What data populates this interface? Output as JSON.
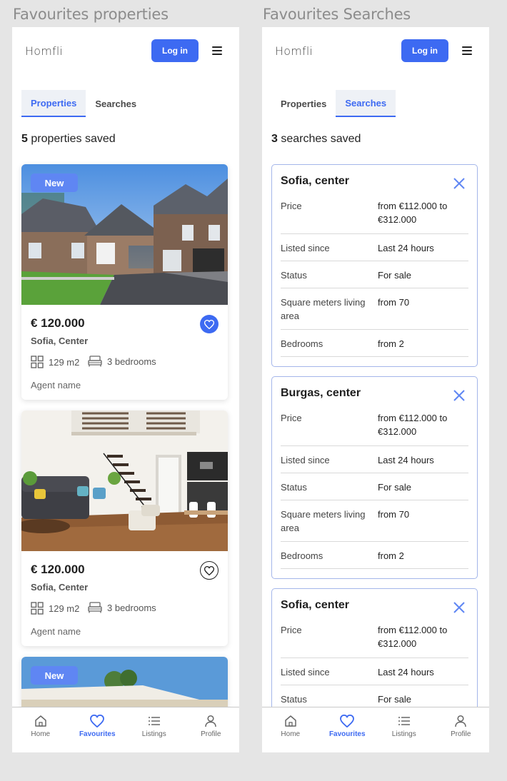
{
  "frames": {
    "left_title": "Favourites properties",
    "right_title": "Favourites Searches"
  },
  "header": {
    "logo": "Homfli",
    "login_label": "Log in"
  },
  "tabs": [
    "Properties",
    "Searches"
  ],
  "properties_view": {
    "active_tab": 0,
    "count": "5",
    "count_suffix": " properties saved",
    "cards": [
      {
        "badge": "New",
        "price": "€ 120.000",
        "location": "Sofia, Center",
        "area": "129 m2",
        "bedrooms": "3 bedrooms",
        "agent": "Agent name",
        "favourite": true
      },
      {
        "badge": "",
        "price": "€ 120.000",
        "location": "Sofia, Center",
        "area": "129 m2",
        "bedrooms": "3 bedrooms",
        "agent": "Agent name",
        "favourite": false
      },
      {
        "badge": "New"
      }
    ]
  },
  "searches_view": {
    "active_tab": 1,
    "count": "3",
    "count_suffix": " searches saved",
    "cards": [
      {
        "title": "Sofia, center",
        "rows": [
          {
            "k": "Price",
            "v": "from €112.000 to €312.000"
          },
          {
            "k": "Listed since",
            "v": "Last 24 hours"
          },
          {
            "k": "Status",
            "v": "For sale"
          },
          {
            "k": "Square meters living area",
            "v": "from 70"
          },
          {
            "k": "Bedrooms",
            "v": "from 2"
          }
        ]
      },
      {
        "title": "Burgas, center",
        "rows": [
          {
            "k": "Price",
            "v": "from €112.000 to €312.000"
          },
          {
            "k": "Listed since",
            "v": "Last 24 hours"
          },
          {
            "k": "Status",
            "v": "For sale"
          },
          {
            "k": "Square meters living area",
            "v": "from 70"
          },
          {
            "k": "Bedrooms",
            "v": "from 2"
          }
        ]
      },
      {
        "title": "Sofia, center",
        "rows": [
          {
            "k": "Price",
            "v": "from €112.000 to €312.000"
          },
          {
            "k": "Listed since",
            "v": "Last 24 hours"
          },
          {
            "k": "Status",
            "v": "For sale"
          }
        ]
      }
    ]
  },
  "bottom_nav": {
    "items": [
      {
        "label": "Home",
        "icon": "home-icon"
      },
      {
        "label": "Favourites",
        "icon": "heart-icon"
      },
      {
        "label": "Listings",
        "icon": "list-icon"
      },
      {
        "label": "Profile",
        "icon": "user-icon"
      }
    ],
    "active_index": 1
  },
  "colors": {
    "accent": "#3d6af2",
    "badge": "#5f86f3",
    "search_border": "#a4b6ea"
  }
}
